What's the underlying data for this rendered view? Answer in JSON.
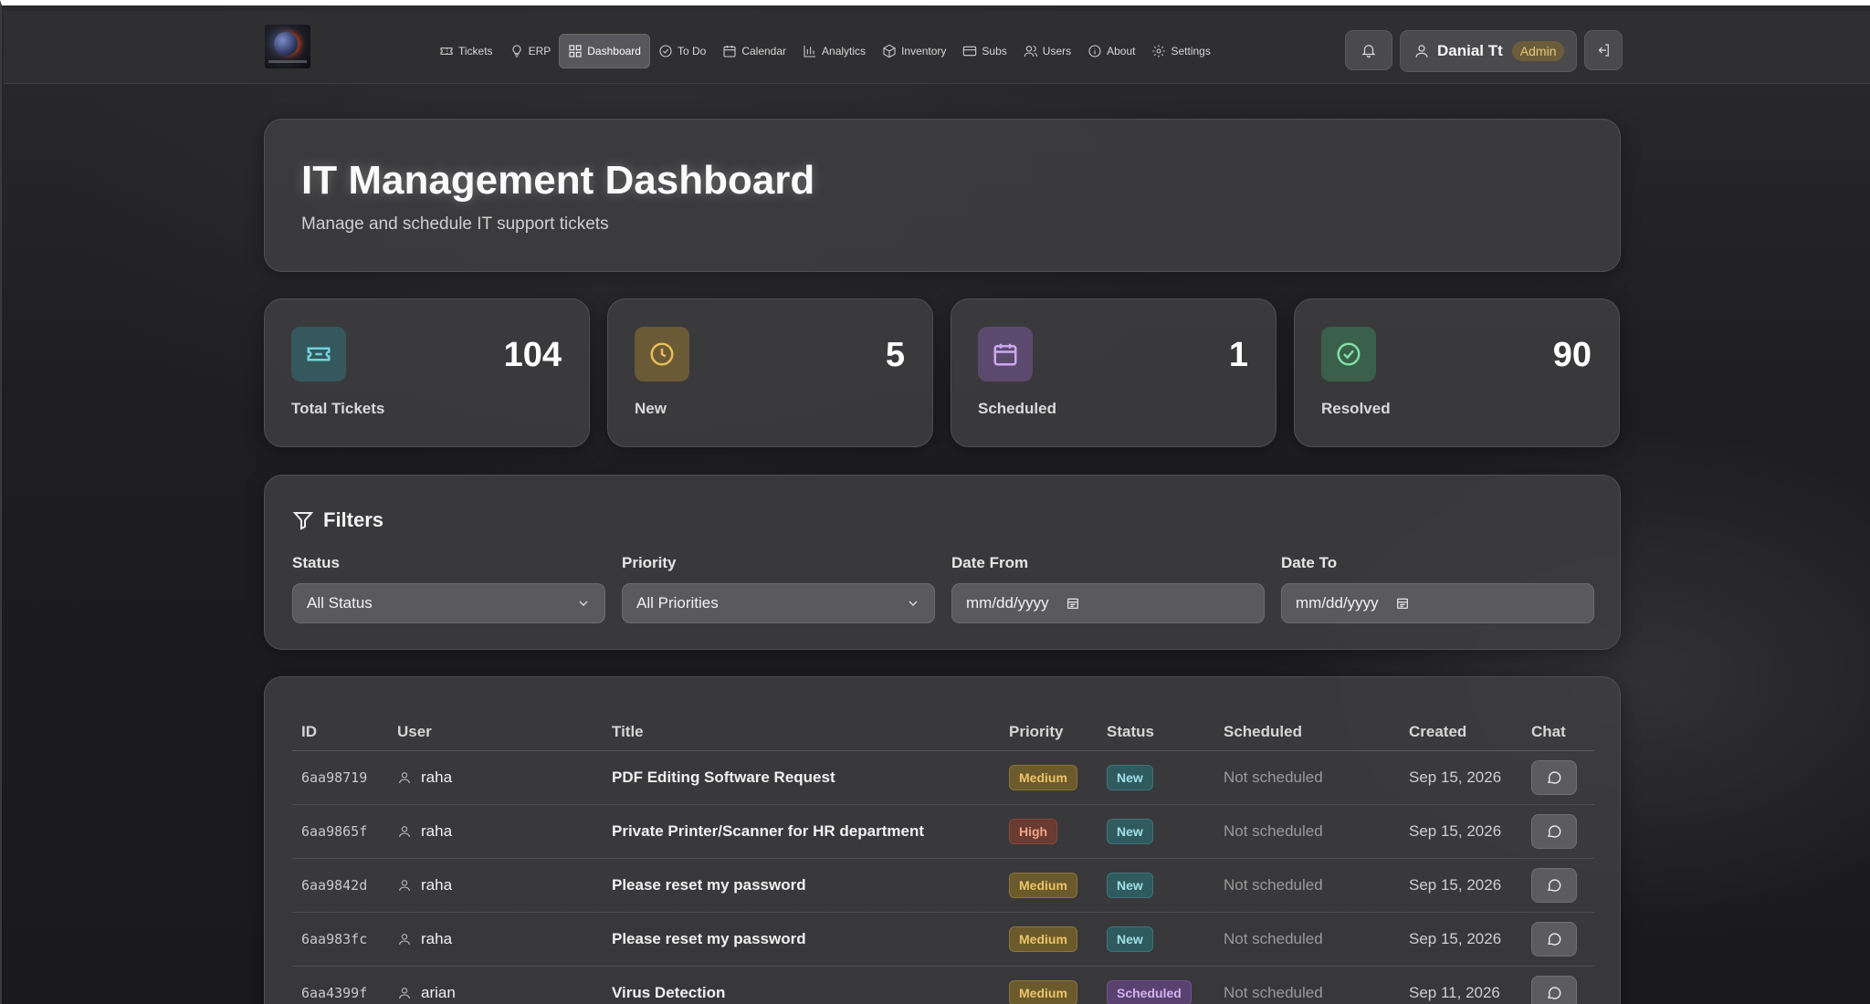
{
  "nav": {
    "items": [
      {
        "label": "Tickets",
        "icon": "ticket-icon"
      },
      {
        "label": "ERP",
        "icon": "lightbulb-icon"
      },
      {
        "label": "Dashboard",
        "icon": "dashboard-icon",
        "active": true
      },
      {
        "label": "To Do",
        "icon": "check-circle-icon"
      },
      {
        "label": "Calendar",
        "icon": "calendar-icon"
      },
      {
        "label": "Analytics",
        "icon": "bar-chart-icon"
      },
      {
        "label": "Inventory",
        "icon": "box-icon"
      },
      {
        "label": "Subs",
        "icon": "credit-card-icon"
      },
      {
        "label": "Users",
        "icon": "users-icon"
      },
      {
        "label": "About",
        "icon": "info-icon"
      },
      {
        "label": "Settings",
        "icon": "gear-icon"
      }
    ]
  },
  "user": {
    "name": "Danial Tt",
    "role": "Admin"
  },
  "header": {
    "title": "IT Management Dashboard",
    "subtitle": "Manage and schedule IT support tickets"
  },
  "stats": [
    {
      "label": "Total Tickets",
      "value": "104",
      "icon": "ticket-icon",
      "color": "#6fd3dc",
      "bg": "#34585c"
    },
    {
      "label": "New",
      "value": "5",
      "icon": "clock-icon",
      "color": "#e9bd5a",
      "bg": "#6a5a36"
    },
    {
      "label": "Scheduled",
      "value": "1",
      "icon": "calendar-icon",
      "color": "#cfa7f2",
      "bg": "#5b4a6e"
    },
    {
      "label": "Resolved",
      "value": "90",
      "icon": "check-circle-icon",
      "color": "#7ee0a6",
      "bg": "#3a5f4a"
    }
  ],
  "filters": {
    "title": "Filters",
    "status": {
      "label": "Status",
      "value": "All Status"
    },
    "priority": {
      "label": "Priority",
      "value": "All Priorities"
    },
    "date_from": {
      "label": "Date From",
      "placeholder": "mm/dd/yyyy"
    },
    "date_to": {
      "label": "Date To",
      "placeholder": "mm/dd/yyyy"
    }
  },
  "table": {
    "columns": [
      "ID",
      "User",
      "Title",
      "Priority",
      "Status",
      "Scheduled",
      "Created",
      "Chat"
    ],
    "rows": [
      {
        "id": "6aa98719",
        "user": "raha",
        "title": "PDF Editing Software Request",
        "priority": "Medium",
        "status": "New",
        "scheduled": "Not scheduled",
        "created": "Sep 15, 2026"
      },
      {
        "id": "6aa9865f",
        "user": "raha",
        "title": "Private Printer/Scanner for HR department",
        "priority": "High",
        "status": "New",
        "scheduled": "Not scheduled",
        "created": "Sep 15, 2026"
      },
      {
        "id": "6aa9842d",
        "user": "raha",
        "title": "Please reset my password",
        "priority": "Medium",
        "status": "New",
        "scheduled": "Not scheduled",
        "created": "Sep 15, 2026"
      },
      {
        "id": "6aa983fc",
        "user": "raha",
        "title": "Please reset my password",
        "priority": "Medium",
        "status": "New",
        "scheduled": "Not scheduled",
        "created": "Sep 15, 2026"
      },
      {
        "id": "6aa4399f",
        "user": "arian",
        "title": "Virus Detection",
        "priority": "Medium",
        "status": "Scheduled",
        "scheduled": "Not scheduled",
        "created": "Sep 11, 2026"
      }
    ]
  }
}
